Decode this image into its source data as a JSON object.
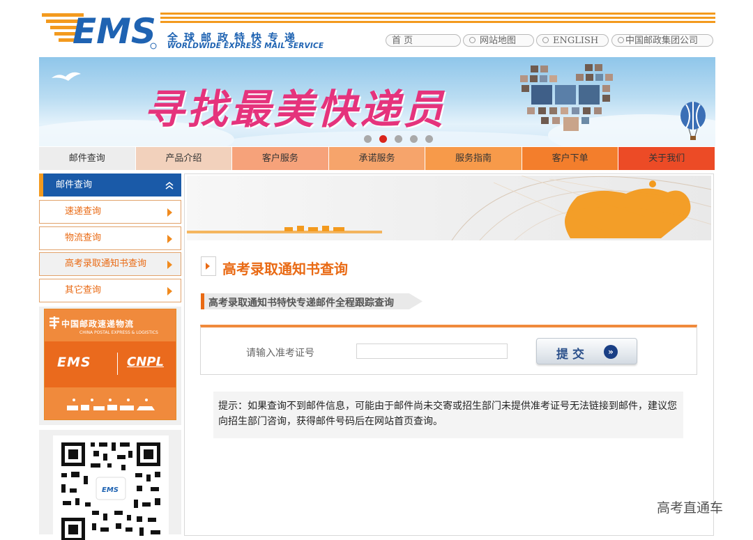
{
  "header": {
    "logo_text": "EMS",
    "logo_cn": "全球邮政特快专递",
    "logo_en": "WORLDWIDE EXPRESS MAIL SERVICE",
    "top_links": [
      {
        "label": "首        页"
      },
      {
        "label": "网站地图"
      },
      {
        "label": "ENGLISH"
      },
      {
        "label": "中国邮政集团公司"
      }
    ]
  },
  "banner": {
    "headline": "寻找最美快递员",
    "active_slide": 2,
    "slide_count": 5
  },
  "nav": {
    "items": [
      {
        "label": "邮件查询",
        "color": "#ededed"
      },
      {
        "label": "产品介绍",
        "color": "#f2d1bc"
      },
      {
        "label": "客户服务",
        "color": "#f6a27a"
      },
      {
        "label": "承诺服务",
        "color": "#f6a46b"
      },
      {
        "label": "服务指南",
        "color": "#f79a4a"
      },
      {
        "label": "客户下单",
        "color": "#f37e2c"
      },
      {
        "label": "关于我们",
        "color": "#ec4b26"
      }
    ]
  },
  "sidebar": {
    "header": "邮件查询",
    "items": [
      {
        "label": "速递查询"
      },
      {
        "label": "物流查询"
      },
      {
        "label": "高考录取通知书查询"
      },
      {
        "label": "其它查询"
      }
    ],
    "ad": {
      "brand_cn": "中国邮政速递物流",
      "brand_en": "CHINA POSTAL EXPRESS & LOGISTICS",
      "ems": "EMS",
      "cnpl": "CNPL"
    }
  },
  "main": {
    "page_title": "高考录取通知书查询",
    "sub_title": "高考录取通知书特快专递邮件全程跟踪查询",
    "form": {
      "label": "请输入准考证号",
      "input_value": "",
      "submit_label": "提交",
      "submit_icon": "»"
    },
    "tip": "提示：如果查询不到邮件信息，可能由于邮件尚未交寄或招生部门未提供准考证号无法链接到邮件，建议您向招生部门咨询，获得邮件号码后在网站首页查询。"
  },
  "watermark": "高考直通车",
  "colors": {
    "brand_orange": "#f39a1e",
    "brand_blue": "#1a5aa8",
    "title_orange": "#e96a14",
    "banner_pink": "#e5337c"
  }
}
